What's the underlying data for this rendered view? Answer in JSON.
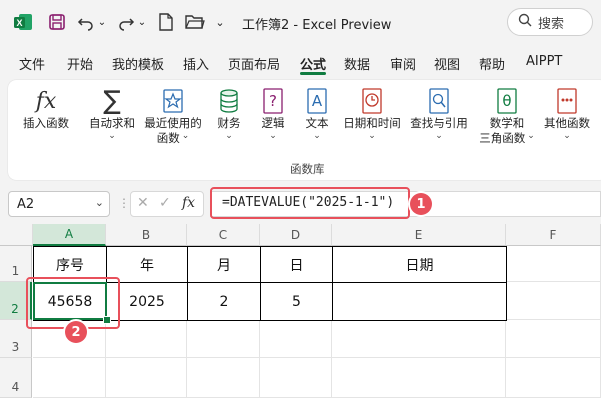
{
  "titlebar": {
    "title": "工作簿2 - Excel Preview",
    "search_label": "搜索",
    "icons": [
      "excel-logo-icon",
      "save-icon",
      "undo-icon",
      "redo-icon",
      "new-file-icon",
      "open-folder-icon",
      "customize-chevron-icon",
      "search-icon"
    ],
    "chevron": "⌄"
  },
  "menu": {
    "items": [
      "文件",
      "开始",
      "我的模板",
      "插入",
      "页面布局",
      "公式",
      "数据",
      "审阅",
      "视图",
      "帮助",
      "AIPPT"
    ],
    "active_index": 5
  },
  "ribbon": {
    "buttons": [
      {
        "label": "插入函数",
        "label2": "",
        "icon": "fx-icon"
      },
      {
        "label": "自动求和",
        "label2": "",
        "icon": "sigma-icon",
        "dropdown": true
      },
      {
        "label": "最近使用的",
        "label2": "函数",
        "icon": "star-icon",
        "dropdown": true
      },
      {
        "label": "财务",
        "label2": "",
        "icon": "database-icon",
        "dropdown": true
      },
      {
        "label": "逻辑",
        "label2": "",
        "icon": "question-book-icon",
        "dropdown": true
      },
      {
        "label": "文本",
        "label2": "",
        "icon": "text-book-icon",
        "dropdown": true
      },
      {
        "label": "日期和时间",
        "label2": "",
        "icon": "clock-book-icon",
        "dropdown": true
      },
      {
        "label": "查找与引用",
        "label2": "",
        "icon": "magnifier-book-icon",
        "dropdown": true
      },
      {
        "label": "数学和",
        "label2": "三角函数",
        "icon": "theta-book-icon",
        "dropdown": true
      },
      {
        "label": "其他函数",
        "label2": "",
        "icon": "more-book-icon",
        "dropdown": true
      }
    ],
    "group_label": "函数库",
    "chev": "⌄"
  },
  "formula_bar": {
    "name_box": "A2",
    "formula": "=DATEVALUE(\"2025-1-1\")",
    "cancel": "✕",
    "enter": "✓",
    "fx": "fx",
    "sep": "⋮"
  },
  "callouts": [
    "1",
    "2"
  ],
  "sheet": {
    "columns": [
      "A",
      "B",
      "C",
      "D",
      "E",
      "F"
    ],
    "rows": [
      "1",
      "2",
      "3",
      "4"
    ],
    "selected_column": "A",
    "selected_row": "2",
    "table_headers": [
      "序号",
      "年",
      "月",
      "日",
      "日期"
    ],
    "table_row": [
      "45658",
      "2025",
      "2",
      "5",
      ""
    ]
  },
  "colors": {
    "accent": "#107c41",
    "highlight": "#e8505b"
  }
}
